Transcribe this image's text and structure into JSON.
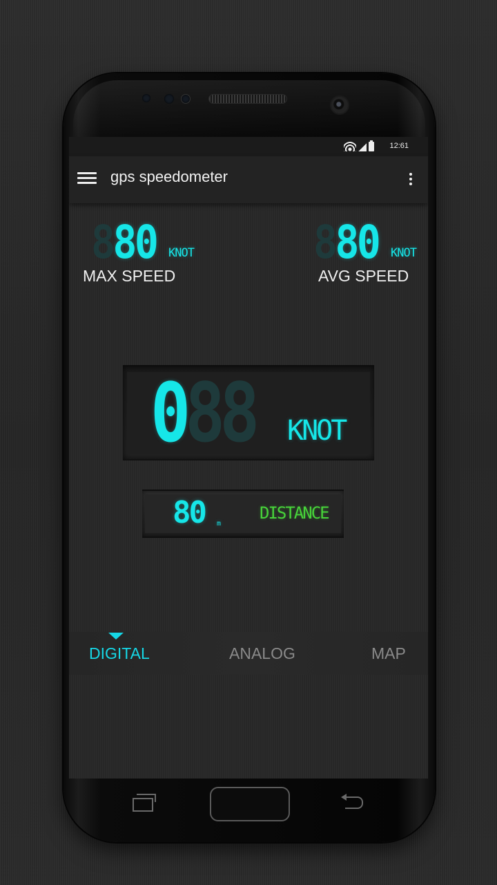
{
  "status_bar": {
    "time": "12:61",
    "icons": [
      "wifi-icon",
      "signal-icon",
      "battery-icon"
    ]
  },
  "app_bar": {
    "title": "gps speedometer",
    "menu_icon": "hamburger-menu-icon",
    "overflow_icon": "overflow-menu-icon"
  },
  "max_speed": {
    "ghost_digit": "8",
    "value": "80",
    "unit": "KNOT",
    "label": "MAX SPEED"
  },
  "avg_speed": {
    "ghost_digit": "8",
    "value": "80",
    "unit": "KNOT",
    "label": "AVG SPEED"
  },
  "current_speed": {
    "value": "0",
    "ghost_digits": "88",
    "unit": "KNOT"
  },
  "distance": {
    "value": "80",
    "unit": "m",
    "label": "DISTANCE"
  },
  "tabs": [
    {
      "label": "DIGITAL",
      "active": true
    },
    {
      "label": "ANALOG",
      "active": false
    },
    {
      "label": "MAP",
      "active": false
    }
  ],
  "colors": {
    "lcd_cyan": "#16e6e8",
    "lcd_green": "#47d33a",
    "tab_active": "#16d7e6",
    "tab_inactive": "#8a8a8a"
  },
  "nav_bar": {
    "icons": [
      "recents-icon",
      "home-icon",
      "back-icon"
    ]
  }
}
